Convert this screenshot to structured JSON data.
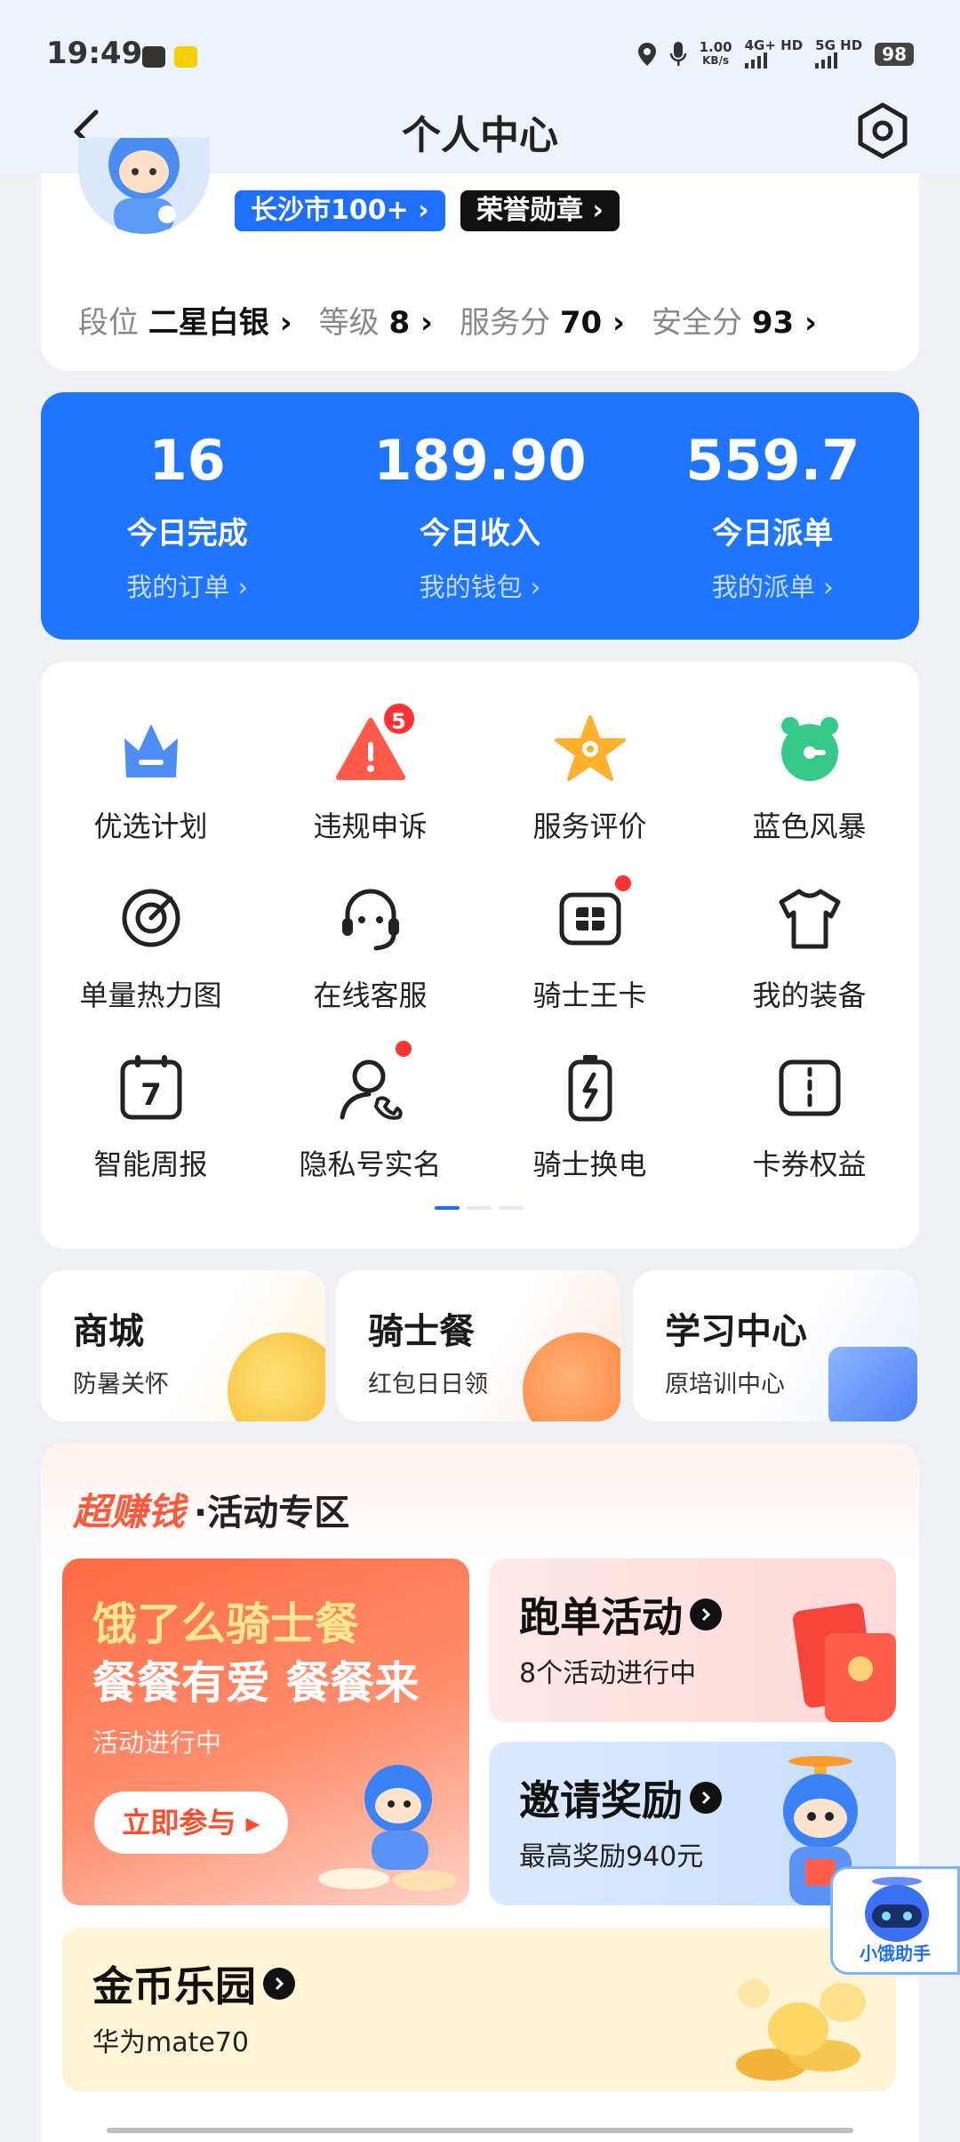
{
  "status_bar": {
    "time": "19:49",
    "net_speed_value": "1.00",
    "net_speed_unit": "KB/s",
    "signal1": "4G+ HD",
    "signal2": "5G HD",
    "battery": "98"
  },
  "nav": {
    "title": "个人中心"
  },
  "profile": {
    "city_badge": "长沙市100+",
    "honor_badge": "荣誉勋章",
    "stats": [
      {
        "label": "段位",
        "value": "二星白银"
      },
      {
        "label": "等级",
        "value": "8"
      },
      {
        "label": "服务分",
        "value": "70"
      },
      {
        "label": "安全分",
        "value": "93"
      }
    ]
  },
  "summary": [
    {
      "value": "16",
      "label": "今日完成",
      "link": "我的订单"
    },
    {
      "value": "189.90",
      "label": "今日收入",
      "link": "我的钱包"
    },
    {
      "value": "559.7",
      "label": "今日派单",
      "link": "我的派单"
    }
  ],
  "services": [
    {
      "label": "优选计划",
      "icon": "crown-icon"
    },
    {
      "label": "违规申诉",
      "icon": "warning-icon",
      "badge": "5"
    },
    {
      "label": "服务评价",
      "icon": "star-icon"
    },
    {
      "label": "蓝色风暴",
      "icon": "alarm-clock-icon"
    },
    {
      "label": "单量热力图",
      "icon": "target-icon"
    },
    {
      "label": "在线客服",
      "icon": "headset-icon"
    },
    {
      "label": "骑士王卡",
      "icon": "sim-card-icon"
    },
    {
      "label": "我的装备",
      "icon": "tshirt-icon"
    },
    {
      "label": "智能周报",
      "icon": "calendar-icon",
      "calendar_day": "7"
    },
    {
      "label": "隐私号实名",
      "icon": "user-phone-icon"
    },
    {
      "label": "骑士换电",
      "icon": "battery-swap-icon"
    },
    {
      "label": "卡券权益",
      "icon": "coupon-icon"
    }
  ],
  "mini_cards": [
    {
      "title": "商城",
      "sub": "防暑关怀"
    },
    {
      "title": "骑士餐",
      "sub": "红包日日领"
    },
    {
      "title": "学习中心",
      "sub": "原培训中心"
    }
  ],
  "activity": {
    "brand": "超赚钱",
    "title": "·活动专区",
    "big_promo": {
      "line1": "饿了么骑士餐",
      "line2": "餐餐有爱 餐餐来",
      "status": "活动进行中",
      "button": "立即参与"
    },
    "run_promo": {
      "title": "跑单活动",
      "sub": "8个活动进行中"
    },
    "invite_promo": {
      "title": "邀请奖励",
      "sub": "最高奖励940元"
    },
    "coin_promo": {
      "title": "金币乐园",
      "sub": "华为mate70"
    }
  },
  "helper": {
    "label": "小饿助手"
  },
  "colors": {
    "primary": "#1f75ff",
    "accent_red": "#ff3b30",
    "brand_orange": "#ff5a3c"
  }
}
